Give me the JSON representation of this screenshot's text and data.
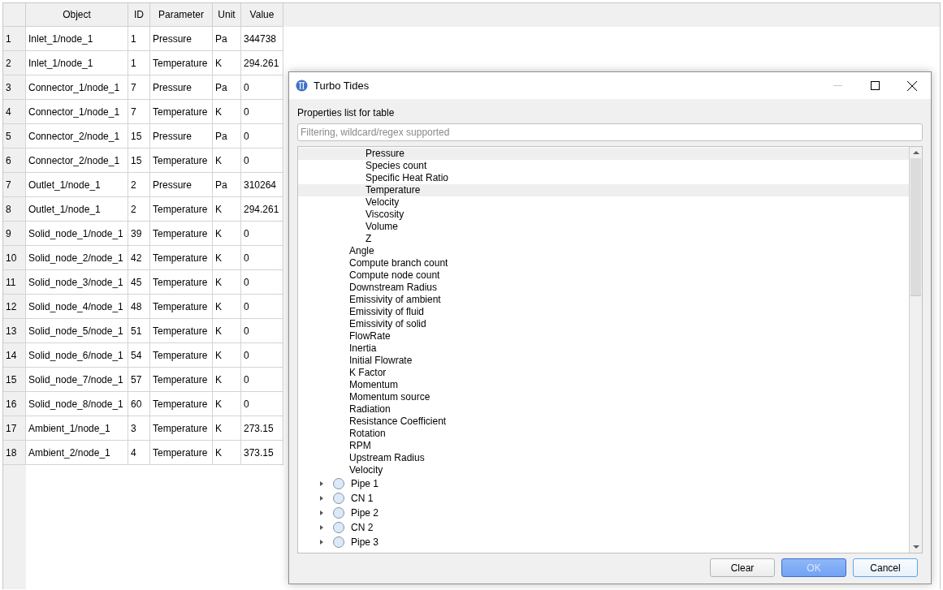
{
  "table": {
    "columns": [
      "Object",
      "ID",
      "Parameter",
      "Unit",
      "Value"
    ],
    "rows": [
      {
        "number": "1",
        "cells": [
          "Inlet_1/node_1",
          "1",
          "Pressure",
          "Pa",
          "344738"
        ]
      },
      {
        "number": "2",
        "cells": [
          "Inlet_1/node_1",
          "1",
          "Temperature",
          "K",
          "294.261"
        ]
      },
      {
        "number": "3",
        "cells": [
          "Connector_1/node_1",
          "7",
          "Pressure",
          "Pa",
          "0"
        ]
      },
      {
        "number": "4",
        "cells": [
          "Connector_1/node_1",
          "7",
          "Temperature",
          "K",
          "0"
        ]
      },
      {
        "number": "5",
        "cells": [
          "Connector_2/node_1",
          "15",
          "Pressure",
          "Pa",
          "0"
        ]
      },
      {
        "number": "6",
        "cells": [
          "Connector_2/node_1",
          "15",
          "Temperature",
          "K",
          "0"
        ]
      },
      {
        "number": "7",
        "cells": [
          "Outlet_1/node_1",
          "2",
          "Pressure",
          "Pa",
          "310264"
        ]
      },
      {
        "number": "8",
        "cells": [
          "Outlet_1/node_1",
          "2",
          "Temperature",
          "K",
          "294.261"
        ]
      },
      {
        "number": "9",
        "cells": [
          "Solid_node_1/node_1",
          "39",
          "Temperature",
          "K",
          "0"
        ]
      },
      {
        "number": "10",
        "cells": [
          "Solid_node_2/node_1",
          "42",
          "Temperature",
          "K",
          "0"
        ]
      },
      {
        "number": "11",
        "cells": [
          "Solid_node_3/node_1",
          "45",
          "Temperature",
          "K",
          "0"
        ]
      },
      {
        "number": "12",
        "cells": [
          "Solid_node_4/node_1",
          "48",
          "Temperature",
          "K",
          "0"
        ]
      },
      {
        "number": "13",
        "cells": [
          "Solid_node_5/node_1",
          "51",
          "Temperature",
          "K",
          "0"
        ]
      },
      {
        "number": "14",
        "cells": [
          "Solid_node_6/node_1",
          "54",
          "Temperature",
          "K",
          "0"
        ]
      },
      {
        "number": "15",
        "cells": [
          "Solid_node_7/node_1",
          "57",
          "Temperature",
          "K",
          "0"
        ]
      },
      {
        "number": "16",
        "cells": [
          "Solid_node_8/node_1",
          "60",
          "Temperature",
          "K",
          "0"
        ]
      },
      {
        "number": "17",
        "cells": [
          "Ambient_1/node_1",
          "3",
          "Temperature",
          "K",
          "273.15"
        ]
      },
      {
        "number": "18",
        "cells": [
          "Ambient_2/node_1",
          "4",
          "Temperature",
          "K",
          "373.15"
        ]
      }
    ]
  },
  "dialog": {
    "title": "Turbo Tides",
    "label": "Properties list for table",
    "filter": {
      "placeholder": "Filtering, wildcard/regex supported"
    },
    "tree": [
      {
        "children": [
          {
            "children": [
              {
                "label": "Pressure",
                "selected": true
              },
              {
                "label": "Species count",
                "selected": false
              },
              {
                "label": "Specific Heat Ratio",
                "selected": false
              },
              {
                "label": "Temperature",
                "selected": true
              },
              {
                "label": "Velocity",
                "selected": false
              },
              {
                "label": "Viscosity",
                "selected": false
              },
              {
                "label": "Volume",
                "selected": false
              },
              {
                "label": "Z",
                "selected": false
              }
            ]
          },
          {
            "label": "Angle",
            "selected": false
          },
          {
            "label": "Compute branch count",
            "selected": false
          },
          {
            "label": "Compute node count",
            "selected": false
          },
          {
            "label": "Downstream Radius",
            "selected": false
          },
          {
            "label": "Emissivity of ambient",
            "selected": false
          },
          {
            "label": "Emissivity of fluid",
            "selected": false
          },
          {
            "label": "Emissivity of solid",
            "selected": false
          },
          {
            "label": "FlowRate",
            "selected": false
          },
          {
            "label": "Inertia",
            "selected": false
          },
          {
            "label": "Initial Flowrate",
            "selected": false
          },
          {
            "label": "K Factor",
            "selected": false
          },
          {
            "label": "Momentum",
            "selected": false
          },
          {
            "label": "Momentum source",
            "selected": false
          },
          {
            "label": "Radiation",
            "selected": false
          },
          {
            "label": "Resistance Coefficient",
            "selected": false
          },
          {
            "label": "Rotation",
            "selected": false
          },
          {
            "label": "RPM",
            "selected": false
          },
          {
            "label": "Upstream Radius",
            "selected": false
          },
          {
            "label": "Velocity",
            "selected": false
          }
        ]
      },
      {
        "label": "Pipe 1",
        "expanded": false,
        "selected": false
      },
      {
        "label": "CN 1",
        "expanded": false,
        "selected": false
      },
      {
        "label": "Pipe 2",
        "expanded": false,
        "selected": false
      },
      {
        "label": "CN 2",
        "expanded": false,
        "selected": false
      },
      {
        "label": "Pipe 3",
        "expanded": false,
        "selected": false
      }
    ],
    "buttons": [
      {
        "label": "Clear",
        "kind": "normal",
        "focused": false
      },
      {
        "label": "OK",
        "kind": "default",
        "focused": false
      },
      {
        "label": "Cancel",
        "kind": "normal",
        "focused": true
      }
    ]
  }
}
